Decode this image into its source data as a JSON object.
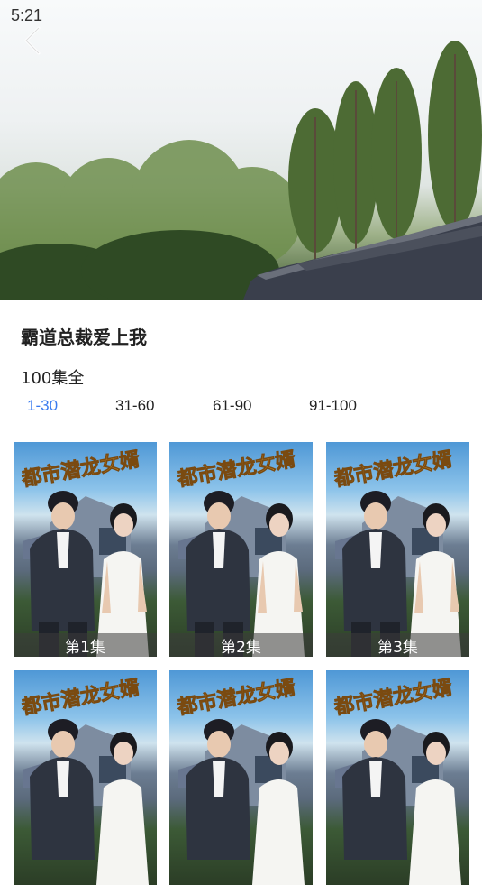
{
  "status": {
    "time": "5:21"
  },
  "drama": {
    "title": "霸道总裁爱上我",
    "episode_count": "100集全"
  },
  "range_tabs": [
    {
      "label": "1-30",
      "active": true
    },
    {
      "label": "31-60",
      "active": false
    },
    {
      "label": "61-90",
      "active": false
    },
    {
      "label": "91-100",
      "active": false
    }
  ],
  "episodes": [
    {
      "label": "第1集",
      "poster_title": "都市潜龙女婿"
    },
    {
      "label": "第2集",
      "poster_title": "都市潜龙女婿"
    },
    {
      "label": "第3集",
      "poster_title": "都市潜龙女婿"
    },
    {
      "label": "",
      "poster_title": "都市潜龙女婿"
    },
    {
      "label": "",
      "poster_title": "都市潜龙女婿"
    },
    {
      "label": "",
      "poster_title": "都市潜龙女婿"
    }
  ],
  "icons": {
    "back": "chevron-left-icon"
  },
  "colors": {
    "accent": "#3a7bef",
    "title_text": "#222222"
  }
}
